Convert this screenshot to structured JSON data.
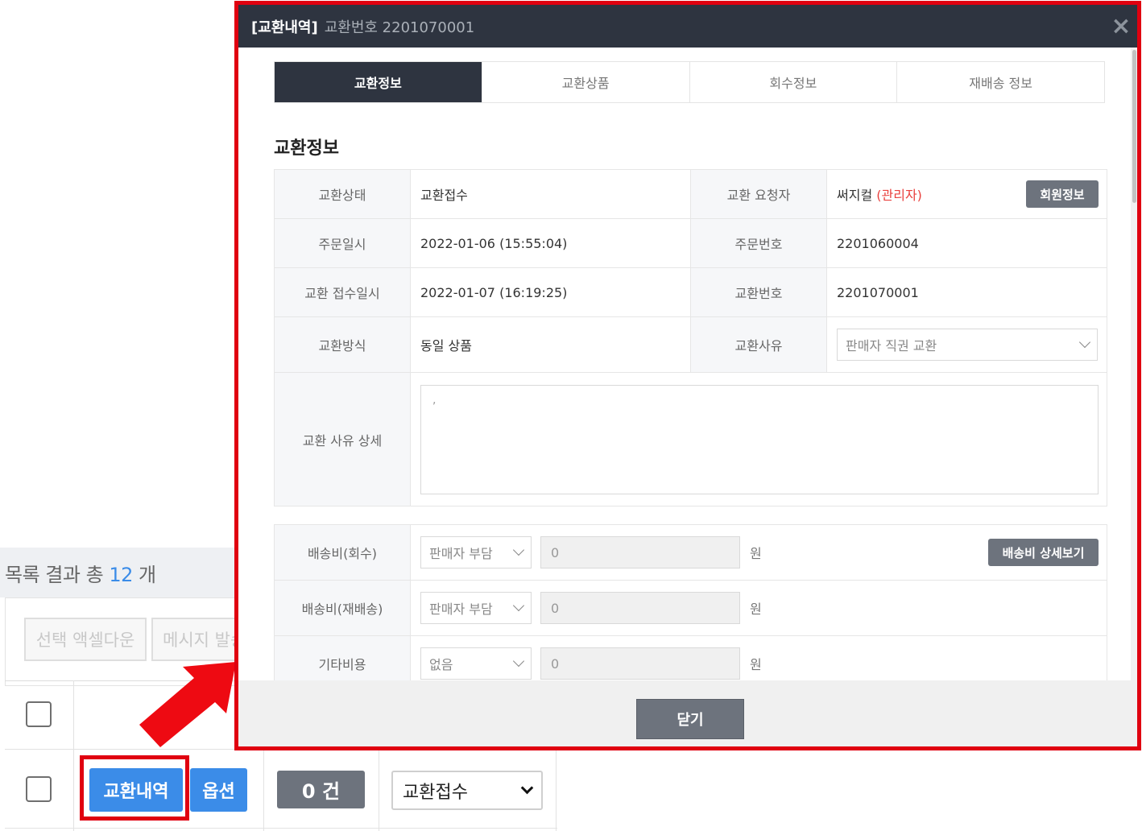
{
  "list": {
    "result_prefix": "목록 결과 총",
    "result_count": "12",
    "result_suffix": "개",
    "excel_download_label": "선택 액셀다운",
    "message_send_label": "메시지 발송",
    "row": {
      "exchange_history_label": "교환내역",
      "option_label": "옵션",
      "count_label": "0 건",
      "status_value": "교환접수",
      "status_chevron": "⌄"
    }
  },
  "modal": {
    "title_main": "[교환내역]",
    "title_sub": "교환번호 2201070001",
    "close_icon": "×",
    "tabs": [
      {
        "label": "교환정보",
        "active": true
      },
      {
        "label": "교환상품",
        "active": false
      },
      {
        "label": "회수정보",
        "active": false
      },
      {
        "label": "재배송 정보",
        "active": false
      }
    ],
    "section_title": "교환정보",
    "info": {
      "status_label": "교환상태",
      "status_value": "교환접수",
      "requester_label": "교환 요청자",
      "requester_name": "써지컬",
      "requester_role": "(관리자)",
      "member_info_button": "회원정보",
      "order_date_label": "주문일시",
      "order_date_value": "2022-01-06 (15:55:04)",
      "order_no_label": "주문번호",
      "order_no_value": "2201060004",
      "received_date_label": "교환 접수일시",
      "received_date_value": "2022-01-07 (16:19:25)",
      "exchange_no_label": "교환번호",
      "exchange_no_value": "2201070001",
      "method_label": "교환방식",
      "method_value": "동일 상품",
      "reason_label": "교환사유",
      "reason_value": "판매자 직권 교환",
      "reason_detail_label": "교환 사유 상세",
      "reason_detail_value": ","
    },
    "costs": {
      "return_fee_label": "배송비(회수)",
      "return_fee_payer": "판매자 부담",
      "return_fee_amount": "0",
      "resend_fee_label": "배송비(재배송)",
      "resend_fee_payer": "판매자 부담",
      "resend_fee_amount": "0",
      "other_fee_label": "기타비용",
      "other_fee_payer": "없음",
      "other_fee_amount": "0",
      "currency_unit": "원",
      "fee_detail_button": "배송비 상세보기"
    },
    "close_button": "닫기"
  },
  "colors": {
    "highlight_red": "#e00010",
    "primary_blue": "#3b8ce8",
    "dark_header": "#2e3440",
    "gray_button": "#6d737d",
    "admin_red": "#e9413e"
  }
}
